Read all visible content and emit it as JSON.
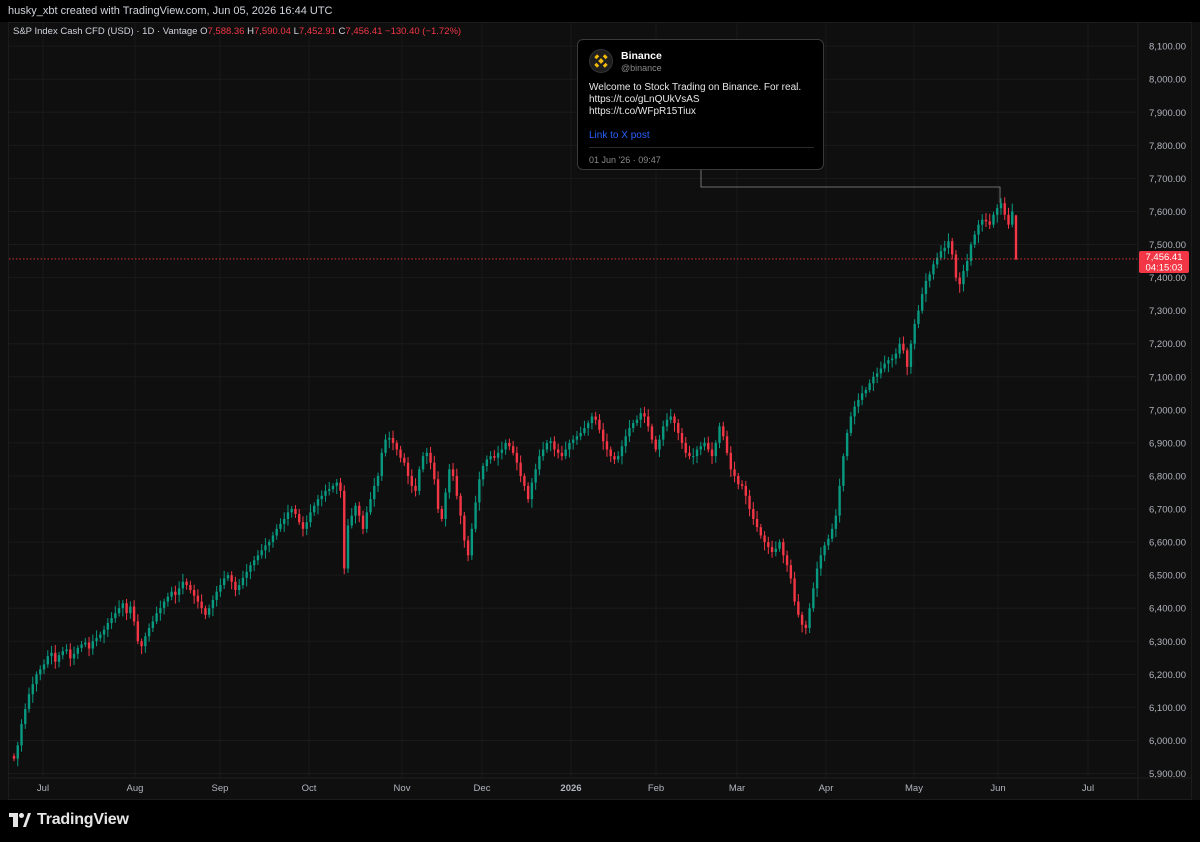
{
  "header": {
    "credit": "husky_xbt created with TradingView.com, Jun 05, 2026 16:44 UTC"
  },
  "legend": {
    "symbol": "S&P Index Cash CFD (USD) · 1D · Vantage",
    "o_label": "O",
    "o_value": "7,588.36",
    "h_label": "H",
    "h_value": "7,590.04",
    "l_label": "L",
    "l_value": "7,452.91",
    "c_label": "C",
    "c_value": "7,456.41",
    "change": "−130.40 (−1.72%)"
  },
  "price_badge": {
    "price": "7,456.41",
    "countdown": "04:15:03",
    "color": "#f23645"
  },
  "colors": {
    "up": "#089981",
    "down": "#f23645",
    "background": "#0f0f0f",
    "grid": "#1a1a1a"
  },
  "tweet": {
    "name": "Binance",
    "handle": "@binance",
    "line1": "Welcome to Stock Trading on Binance. For real.",
    "line2": "https://t.co/gLnQUkVsAS",
    "line3": "https://t.co/WFpR15Tiux",
    "link": "Link to X post",
    "date": "01 Jun '26 · 09:47",
    "icon": "binance-logo-icon"
  },
  "branding": {
    "logo_text": "TradingView",
    "icon": "tradingview-logo-icon"
  },
  "chart_data": {
    "type": "candlestick",
    "title": "S&P Index Cash CFD (USD) · 1D · Vantage",
    "ylim": [
      5870,
      8160
    ],
    "y_ticks": [
      "8,100.00",
      "8,000.00",
      "7,900.00",
      "7,800.00",
      "7,700.00",
      "7,600.00",
      "7,500.00",
      "7,400.00",
      "7,300.00",
      "7,200.00",
      "7,100.00",
      "7,000.00",
      "6,900.00",
      "6,800.00",
      "6,700.00",
      "6,600.00",
      "6,500.00",
      "6,400.00",
      "6,300.00",
      "6,200.00",
      "6,100.00",
      "6,000.00",
      "5,900.00"
    ],
    "x_ticks": [
      "Jul",
      "Aug",
      "Sep",
      "Oct",
      "Nov",
      "Dec",
      "2026",
      "Feb",
      "Mar",
      "Apr",
      "May",
      "Jun",
      "Jul"
    ],
    "grid": true,
    "last_price": 7456.41,
    "closes": [
      5945,
      5985,
      6050,
      6095,
      6140,
      6170,
      6200,
      6215,
      6230,
      6255,
      6265,
      6238,
      6258,
      6270,
      6275,
      6248,
      6262,
      6280,
      6290,
      6296,
      6278,
      6300,
      6310,
      6320,
      6335,
      6355,
      6370,
      6385,
      6400,
      6415,
      6385,
      6405,
      6360,
      6300,
      6285,
      6315,
      6340,
      6360,
      6385,
      6400,
      6420,
      6435,
      6450,
      6440,
      6460,
      6480,
      6470,
      6455,
      6438,
      6420,
      6400,
      6380,
      6400,
      6425,
      6450,
      6470,
      6490,
      6500,
      6480,
      6455,
      6470,
      6492,
      6510,
      6530,
      6545,
      6560,
      6575,
      6590,
      6600,
      6620,
      6640,
      6655,
      6670,
      6690,
      6700,
      6685,
      6660,
      6640,
      6660,
      6690,
      6710,
      6730,
      6740,
      6755,
      6760,
      6770,
      6780,
      6755,
      6520,
      6650,
      6680,
      6710,
      6680,
      6640,
      6690,
      6730,
      6770,
      6800,
      6870,
      6910,
      6915,
      6900,
      6880,
      6855,
      6840,
      6800,
      6770,
      6755,
      6820,
      6860,
      6870,
      6840,
      6790,
      6700,
      6670,
      6750,
      6820,
      6800,
      6740,
      6680,
      6605,
      6560,
      6640,
      6720,
      6790,
      6830,
      6850,
      6860,
      6855,
      6870,
      6880,
      6900,
      6890,
      6870,
      6840,
      6800,
      6770,
      6730,
      6780,
      6820,
      6860,
      6880,
      6900,
      6905,
      6880,
      6870,
      6860,
      6880,
      6900,
      6910,
      6920,
      6930,
      6945,
      6960,
      6980,
      6970,
      6940,
      6905,
      6880,
      6860,
      6850,
      6860,
      6890,
      6920,
      6945,
      6960,
      6970,
      6990,
      6980,
      6950,
      6910,
      6880,
      6910,
      6950,
      6970,
      6980,
      6960,
      6930,
      6900,
      6870,
      6860,
      6860,
      6880,
      6890,
      6900,
      6880,
      6860,
      6900,
      6950,
      6920,
      6870,
      6820,
      6800,
      6775,
      6770,
      6740,
      6700,
      6670,
      6645,
      6620,
      6600,
      6585,
      6570,
      6580,
      6600,
      6560,
      6530,
      6490,
      6420,
      6380,
      6350,
      6340,
      6400,
      6460,
      6520,
      6560,
      6590,
      6610,
      6640,
      6680,
      6770,
      6860,
      6930,
      6980,
      7010,
      7030,
      7050,
      7060,
      7080,
      7100,
      7110,
      7125,
      7140,
      7150,
      7155,
      7170,
      7200,
      7180,
      7130,
      7200,
      7260,
      7300,
      7350,
      7390,
      7410,
      7440,
      7460,
      7480,
      7490,
      7510,
      7470,
      7400,
      7380,
      7420,
      7450,
      7500,
      7530,
      7560,
      7575,
      7570,
      7560,
      7590,
      7610,
      7625,
      7590,
      7560,
      7600,
      7456
    ],
    "events": [
      {
        "label": "Binance post",
        "date": "01 Jun '26"
      }
    ]
  }
}
